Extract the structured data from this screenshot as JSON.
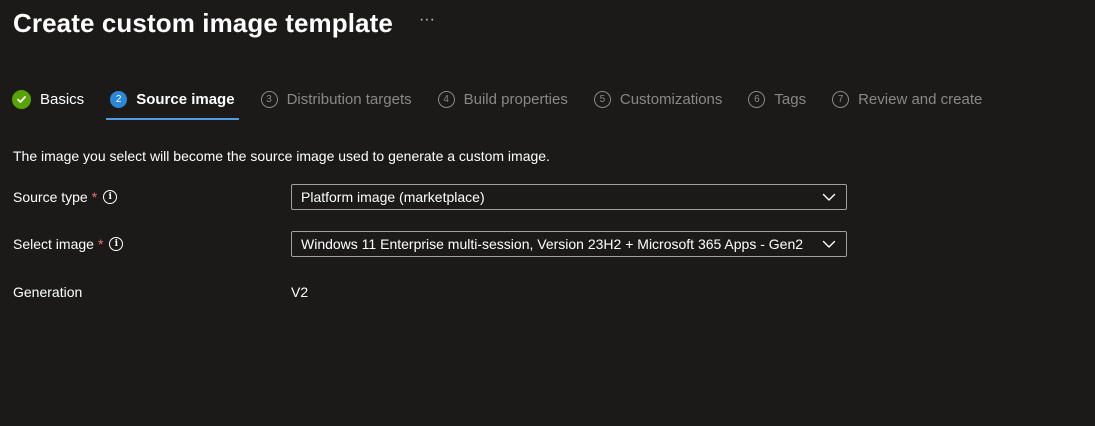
{
  "header": {
    "title": "Create custom image template",
    "more": "···"
  },
  "tabs": [
    {
      "step": "✓",
      "label": "Basics",
      "state": "done"
    },
    {
      "step": "2",
      "label": "Source image",
      "state": "active"
    },
    {
      "step": "3",
      "label": "Distribution targets",
      "state": "todo"
    },
    {
      "step": "4",
      "label": "Build properties",
      "state": "todo"
    },
    {
      "step": "5",
      "label": "Customizations",
      "state": "todo"
    },
    {
      "step": "6",
      "label": "Tags",
      "state": "todo"
    },
    {
      "step": "7",
      "label": "Review and create",
      "state": "todo"
    }
  ],
  "description": "The image you select will become the source image used to generate a custom image.",
  "form": {
    "source_type": {
      "label": "Source type",
      "required": "*",
      "value": "Platform image (marketplace)"
    },
    "select_image": {
      "label": "Select image",
      "required": "*",
      "value": "Windows 11 Enterprise multi-session, Version 23H2 + Microsoft 365 Apps - Gen2"
    },
    "generation": {
      "label": "Generation",
      "value": "V2"
    }
  },
  "colors": {
    "background": "#1b1a19",
    "accent": "#2b88d8",
    "success": "#57a300",
    "required": "#f1707b"
  }
}
